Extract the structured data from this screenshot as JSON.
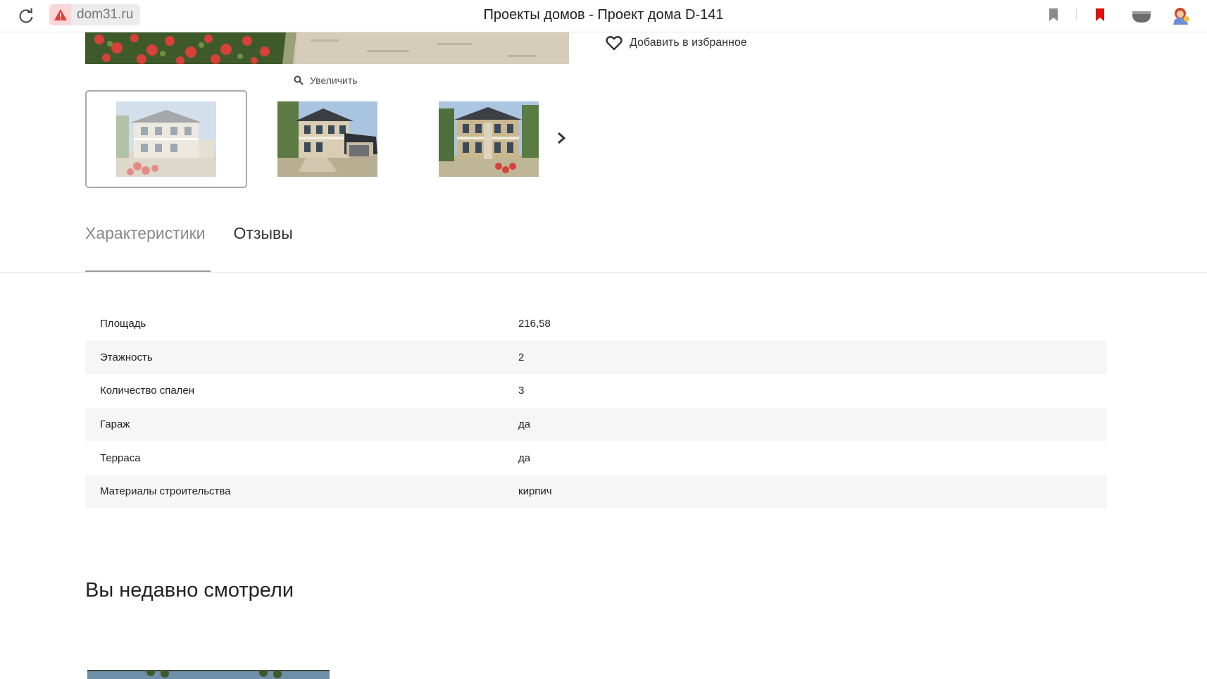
{
  "browser": {
    "domain": "dom31.ru",
    "title": "Проекты домов - Проект дома D-141",
    "colors": {
      "warning": "#e53935",
      "bookmark_active": "#e01010"
    },
    "icons": [
      "reload-icon",
      "warning-icon",
      "bookmark-icon",
      "bookmark-red-icon",
      "extension-icon",
      "avatar-icon"
    ]
  },
  "product": {
    "favorite_label": "Добавить в избранное",
    "zoom_label": "Увеличить",
    "thumbnails": [
      "thumbnail-1",
      "thumbnail-2",
      "thumbnail-3"
    ]
  },
  "tabs": [
    {
      "label": "Характеристики",
      "active": true
    },
    {
      "label": "Отзывы",
      "active": false
    }
  ],
  "specs": [
    {
      "name": "Площадь",
      "value": "216,58"
    },
    {
      "name": "Этажность",
      "value": "2"
    },
    {
      "name": "Количество спален",
      "value": "3"
    },
    {
      "name": "Гараж",
      "value": "да"
    },
    {
      "name": "Терраса",
      "value": "да"
    },
    {
      "name": "Материалы строительства",
      "value": "кирпич"
    }
  ],
  "recent": {
    "title": "Вы недавно смотрели"
  }
}
